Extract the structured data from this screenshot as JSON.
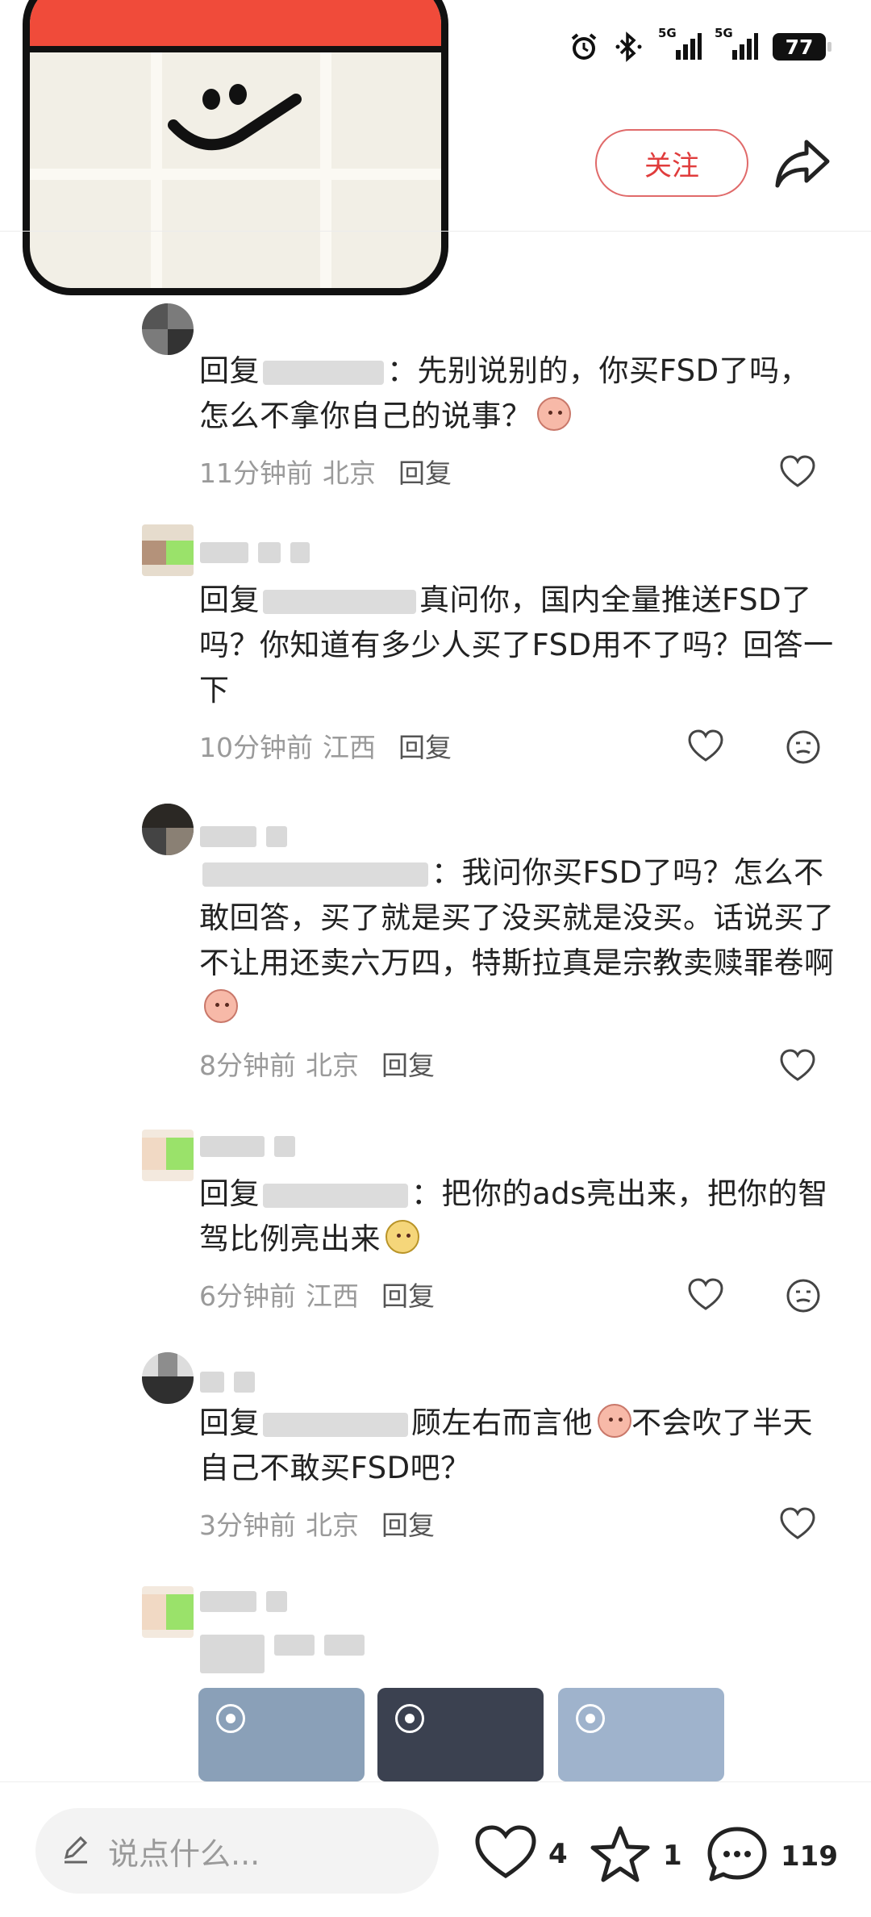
{
  "header": {
    "follow_label": "关注"
  },
  "status_bar": {
    "battery": "77",
    "signal1": "5G",
    "signal2": "5G"
  },
  "comments": [
    {
      "prefix": "回复",
      "text": "：先别说别的，你买FSD了吗，怎么不拿你自己的说事？",
      "time": "11分钟前",
      "location": "北京",
      "reply_label": "回复"
    },
    {
      "prefix": "回复",
      "text": "真问你，国内全量推送FSD了吗？你知道有多少人买了FSD用不了吗？回答一下",
      "time": "10分钟前",
      "location": "江西",
      "reply_label": "回复"
    },
    {
      "prefix": "",
      "text": "：我问你买FSD了吗？怎么不敢回答，买了就是买了没买就是没买。话说买了不让用还卖六万四，特斯拉真是宗教卖赎罪卷啊",
      "time": "8分钟前",
      "location": "北京",
      "reply_label": "回复"
    },
    {
      "prefix": "回复",
      "text": "：把你的ads亮出来，把你的智驾比例亮出来",
      "time": "6分钟前",
      "location": "江西",
      "reply_label": "回复"
    },
    {
      "prefix": "回复",
      "text": "顾左右而言他",
      "text2": "不会吹了半天自己不敢买FSD吧？",
      "time": "3分钟前",
      "location": "北京",
      "reply_label": "回复"
    }
  ],
  "bottom_bar": {
    "input_placeholder": "说点什么...",
    "like_count": "4",
    "favorite_count": "1",
    "comment_count": "119"
  },
  "colors": {
    "accent": "#e03c3c",
    "calendar_red": "#f04b3a"
  }
}
